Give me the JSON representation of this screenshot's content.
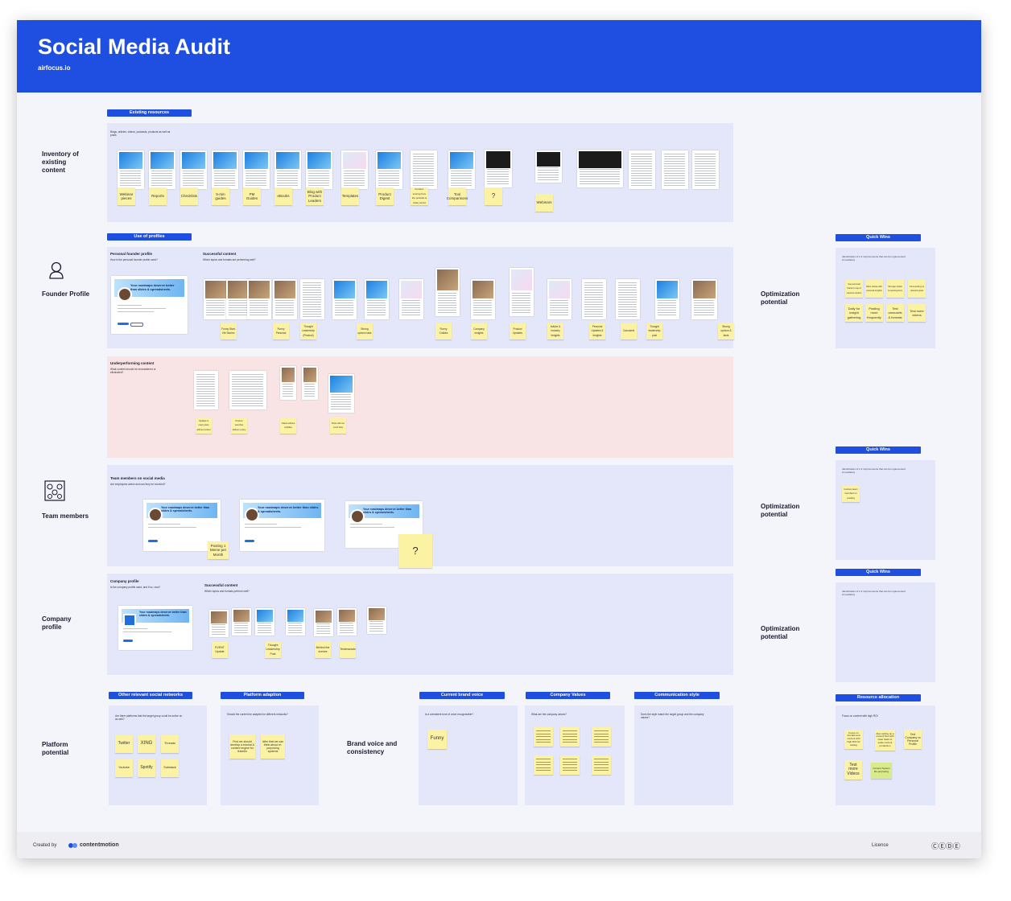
{
  "header": {
    "title": "Social Media Audit",
    "subtitle": "airfocus.io"
  },
  "rows": {
    "inventory": "Inventory of existing content",
    "founder": "Founder Profile",
    "team": "Team members",
    "company": "Company profile",
    "platform": "Platform potential"
  },
  "pills": {
    "existing_resources": "Existing resources",
    "use_of_profiles": "Use of profiles",
    "quick_wins": "Quick Wins",
    "other_networks": "Other relevant social networks",
    "platform_adaption": "Platform adaption",
    "brand_voice": "Current brand voice",
    "company_values": "Company Values",
    "communication_style": "Communication style",
    "resource_allocation": "Resource allocation"
  },
  "panels": {
    "existing_q": "Blogs, articles, videos, podcasts, products as well as posts",
    "personal_founder": "Personal founder profile",
    "personal_founder_q": "How is the personal founder profile used?",
    "successful_content": "Successful content",
    "successful_content_q": "Which topics and formats are performing well?",
    "underperforming": "Underperforming content",
    "underperforming_q": "What content should be reconsidered or eliminated?",
    "team_social": "Team members on social media",
    "team_social_q": "Are employees active and can they be involved?",
    "company_profile": "Company profile",
    "company_profile_q": "Is the company profile used, and if so, how?",
    "company_successful": "Successful content",
    "company_successful_q": "Which topics and formats perform well?",
    "other_networks_q": "Are there platforms that the target group could be active on as well?",
    "platform_adaption_q": "Should the content be adapted for different networks?",
    "brand_voice_label": "Brand voice and consistency",
    "brand_voice_q": "Is a consistent tone of voice recognizable?",
    "company_values_q": "What are the company values?",
    "communication_q": "Does the style match the target group and the company values?",
    "quick_wins_q": "Identification of 1-3 improvements that can be implemented immediately",
    "resource_q": "Focus on content with high ROI"
  },
  "optimization": "Optimization potential",
  "inventory_stickies": [
    "Webinar pieces",
    "Reports",
    "Checklists",
    "5-min guides",
    "PM Guides",
    "eBooks",
    "Blog with Product Leaders",
    "Templates",
    "Product Digest",
    "Content-scoring from the podcast & video series",
    "Tool Comparisons",
    "?",
    "Webinars"
  ],
  "founder_stickies": [
    "Funny Start-life Stories",
    "Funny Personal",
    "Thought Leadership (Product)",
    "Strong opinion take",
    "Funny Collabs",
    "Company Insights",
    "Product Updates",
    "Advice & Industry Insights",
    "Personal Updates & Insights",
    "Carousels",
    "Thought leadership post",
    "Strong opinion & facts"
  ],
  "founder_quickwins": [
    "Use personal brand on top of success content",
    "More stories with personal insights",
    "Stronger hooks & opening lines",
    "Commenting on relevant posts",
    "Daily for insight gathering",
    "Posting more frequently",
    "Test carousels & formats",
    "Test more videos"
  ],
  "under_stickies": [
    "Updates & news posts without context",
    "Product launches without a story",
    "Videos without subtitles",
    "Posts with too much links"
  ],
  "team_quickwin": "Involve team members in posting",
  "team_stickies": {
    "posting": "Posting 1 Meme per Month",
    "unknown": "?"
  },
  "profile_texts": {
    "brand": "airfocus",
    "headline": "Your roadmaps deserve better than slides & spreadsheets."
  },
  "company_stickies": [
    "EVENT Update",
    "Thought Leadership Post",
    "Behind the scenes",
    "Testimonials"
  ],
  "network_stickies": [
    "Twitter",
    "XING",
    "Threads",
    "Youtube",
    "Spotify",
    "Substack"
  ],
  "adaption_stickies": [
    "First we should develop a tutorial & content engine for linkedin",
    "After that we can think about re-purposing systems"
  ],
  "brand_sticky": "Funny",
  "resource_stickies": [
    "Focus on formats and content with high ROI for testing",
    "Also setting up a content flow with clear tasks to scale content production",
    "Test Company vs Personal Profile",
    "Test more Videos",
    "Content System Re-purposing"
  ],
  "footer": {
    "created_by": "Created by",
    "brand": "contentmotion",
    "licence": "Licence",
    "cc": "ⒸⒺⒹⒺ"
  }
}
